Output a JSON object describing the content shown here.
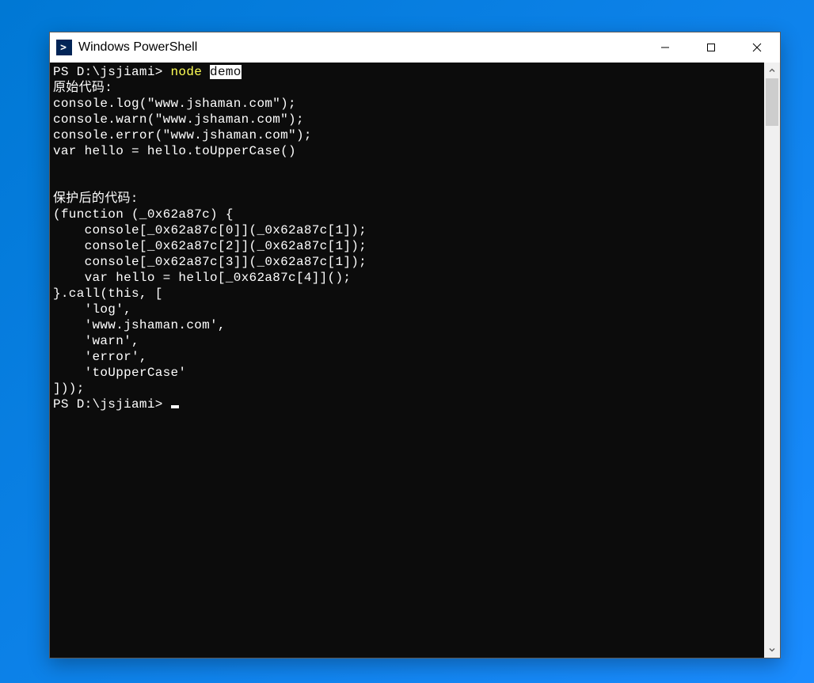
{
  "window": {
    "title": "Windows PowerShell",
    "icon_glyph": ">_"
  },
  "terminal": {
    "prompt1_path": "PS D:\\jsjiami> ",
    "cmd_node": "node ",
    "cmd_demo": "demo",
    "lines": [
      "原始代码:",
      "console.log(\"www.jshaman.com\");",
      "console.warn(\"www.jshaman.com\");",
      "console.error(\"www.jshaman.com\");",
      "var hello = hello.toUpperCase()",
      "",
      "",
      "保护后的代码:",
      "(function (_0x62a87c) {",
      "    console[_0x62a87c[0]](_0x62a87c[1]);",
      "    console[_0x62a87c[2]](_0x62a87c[1]);",
      "    console[_0x62a87c[3]](_0x62a87c[1]);",
      "    var hello = hello[_0x62a87c[4]]();",
      "}.call(this, [",
      "    'log',",
      "    'www.jshaman.com',",
      "    'warn',",
      "    'error',",
      "    'toUpperCase'",
      "]));"
    ],
    "prompt2_path": "PS D:\\jsjiami> "
  }
}
